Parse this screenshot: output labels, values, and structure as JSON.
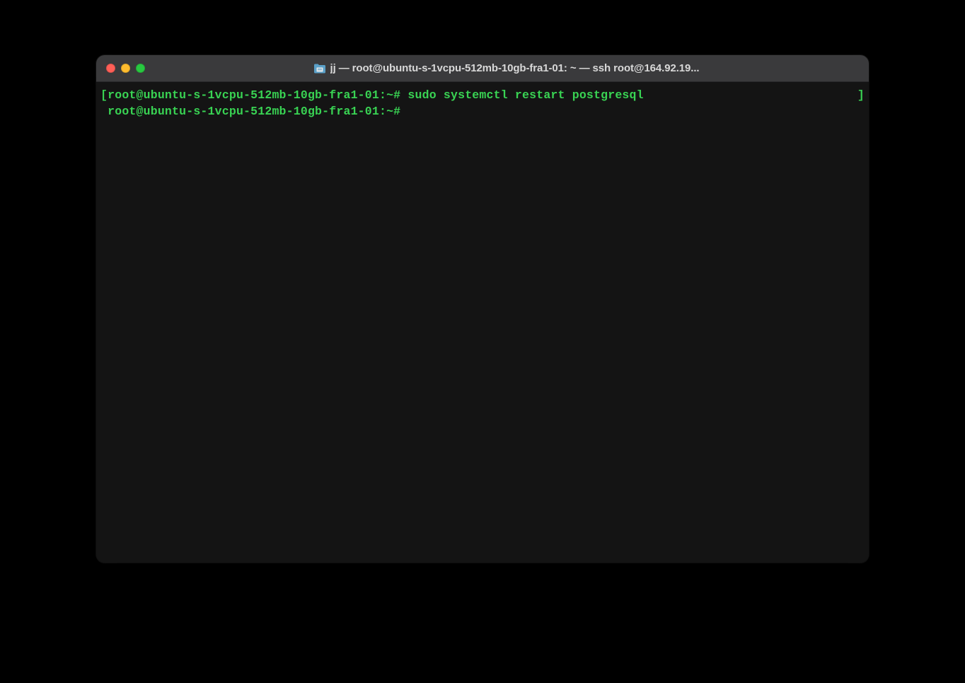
{
  "titlebar": {
    "title": "jj — root@ubuntu-s-1vcpu-512mb-10gb-fra1-01: ~ — ssh root@164.92.19..."
  },
  "terminal": {
    "lines": [
      {
        "open_bracket": "[",
        "prompt": "root@ubuntu-s-1vcpu-512mb-10gb-fra1-01:~#",
        "command": " sudo systemctl restart postgresql",
        "close_bracket": "]"
      },
      {
        "open_bracket": " ",
        "prompt": "root@ubuntu-s-1vcpu-512mb-10gb-fra1-01:~#",
        "command": "",
        "close_bracket": ""
      }
    ]
  }
}
